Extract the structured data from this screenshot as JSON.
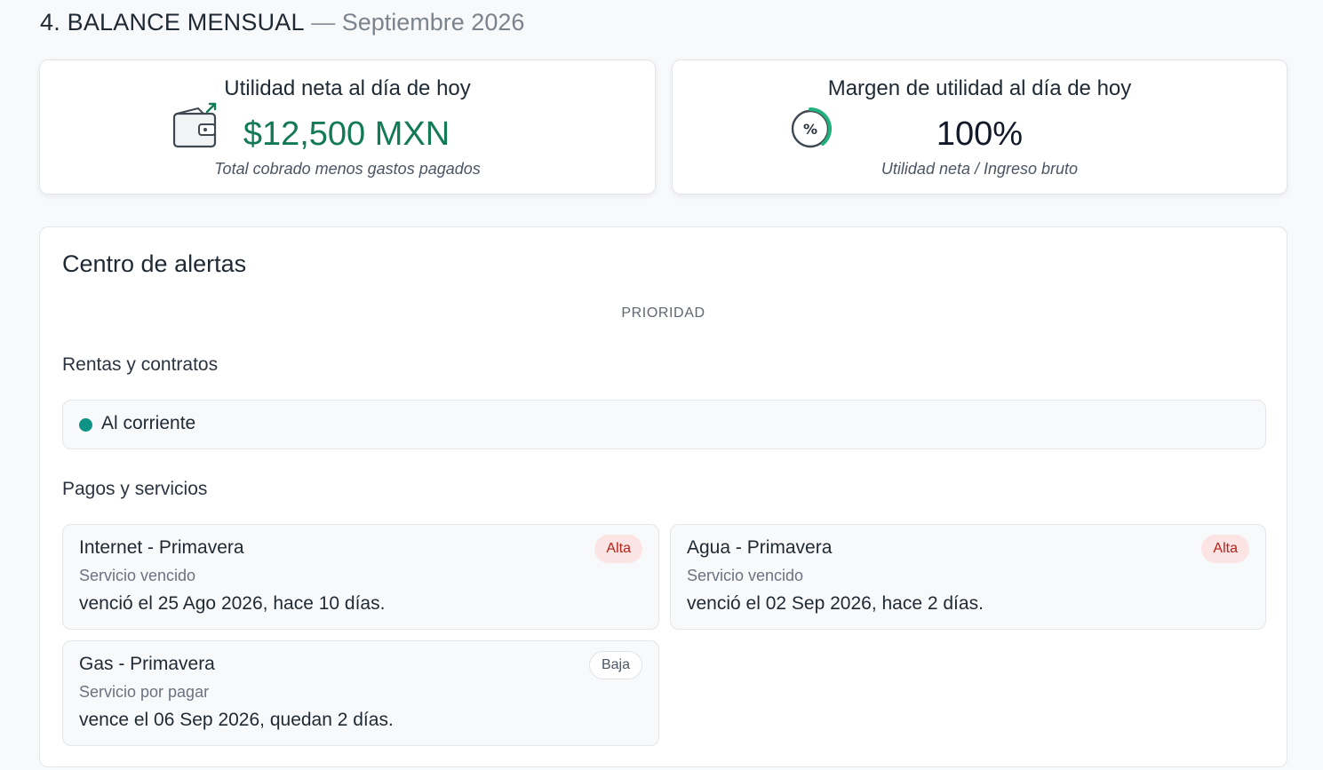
{
  "header": {
    "title": "4. BALANCE MENSUAL",
    "separator": "—",
    "period": "Septiembre 2026"
  },
  "kpis": {
    "net_profit": {
      "title": "Utilidad neta al día de hoy",
      "value": "$12,500 MXN",
      "subtitle": "Total cobrado menos gastos pagados",
      "icon": "wallet-icon",
      "color": "#127a55"
    },
    "margin": {
      "title": "Margen de utilidad al día de hoy",
      "value": "100%",
      "subtitle": "Utilidad neta / Ingreso bruto",
      "icon": "percent-gauge-icon"
    }
  },
  "alerts": {
    "title": "Centro de alertas",
    "priority_label": "PRIORIDAD",
    "rentas": {
      "title": "Rentas y contratos",
      "status": "Al corriente",
      "status_color": "#0e9384"
    },
    "pagos": {
      "title": "Pagos y servicios",
      "items": [
        {
          "title": "Internet - Primavera",
          "status": "Servicio vencido",
          "detail": "venció el 25 Ago 2026, hace 10 días.",
          "priority": "Alta"
        },
        {
          "title": "Agua - Primavera",
          "status": "Servicio vencido",
          "detail": "venció el 02 Sep 2026, hace 2 días.",
          "priority": "Alta"
        },
        {
          "title": "Gas - Primavera",
          "status": "Servicio por pagar",
          "detail": "vence el 06 Sep 2026, quedan 2 días.",
          "priority": "Baja"
        }
      ]
    }
  },
  "colors": {
    "alta_bg": "#fde4e4",
    "alta_text": "#b42318",
    "accent_green": "#127a55"
  }
}
